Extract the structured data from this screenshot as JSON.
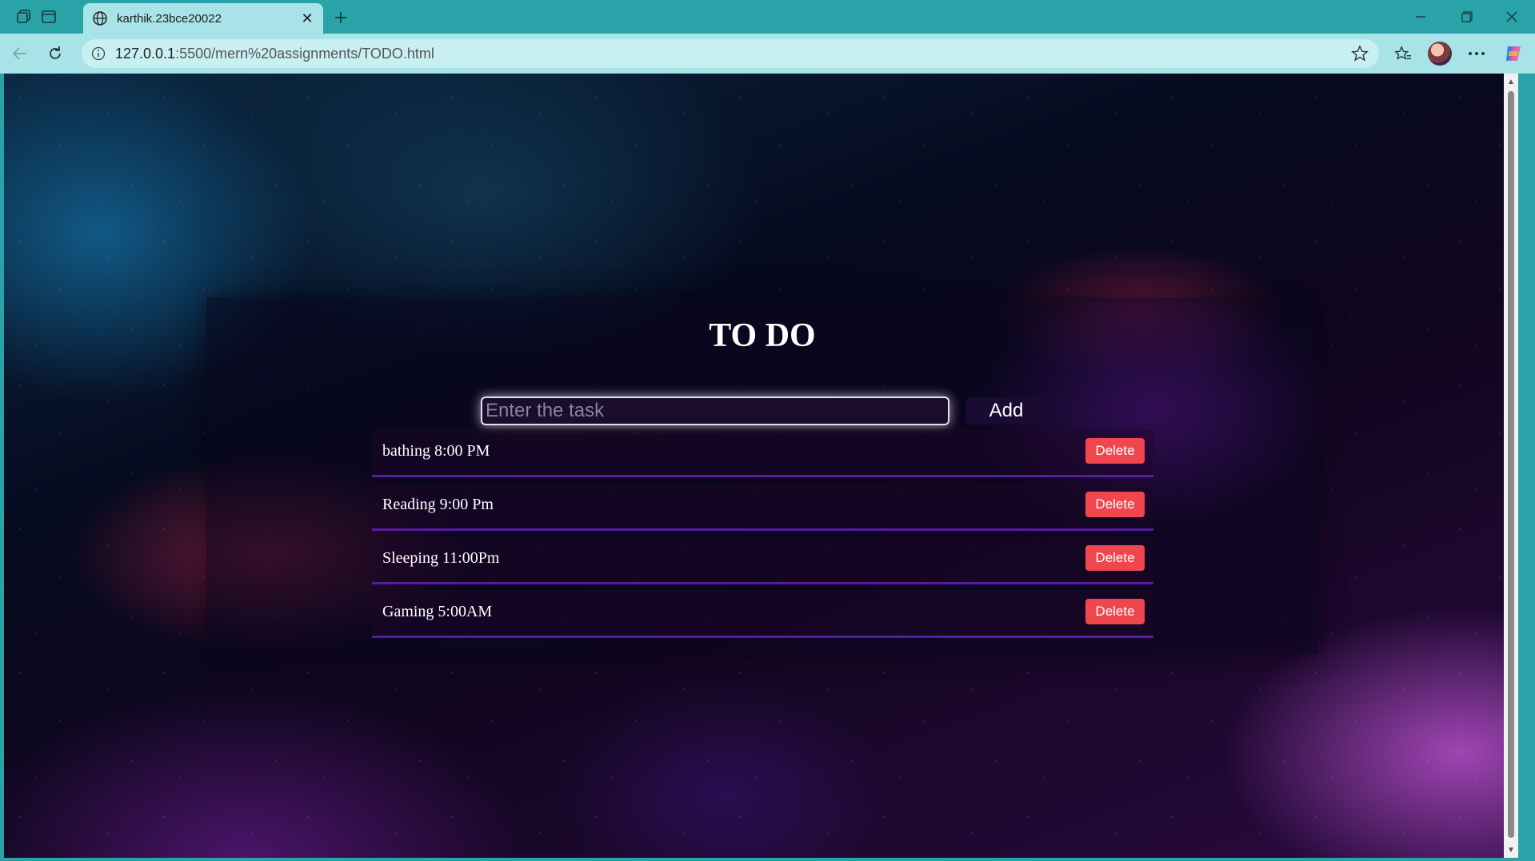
{
  "browser": {
    "tab_title": "karthik.23bce20022",
    "url_host": "127.0.0.1",
    "url_rest": ":5500/mern%20assignments/TODO.html"
  },
  "page": {
    "title": "TO DO",
    "input_placeholder": "Enter the task",
    "input_value": "",
    "add_label": "Add",
    "tasks": [
      {
        "text": "bathing 8:00 PM",
        "delete_label": "Delete"
      },
      {
        "text": "Reading 9:00 Pm",
        "delete_label": "Delete"
      },
      {
        "text": "Sleeping 11:00Pm",
        "delete_label": "Delete"
      },
      {
        "text": "Gaming 5:00AM",
        "delete_label": "Delete"
      }
    ]
  },
  "colors": {
    "chrome_accent": "#2aa3a8",
    "delete_button": "#f0474f",
    "add_button": "#1a0b33"
  }
}
